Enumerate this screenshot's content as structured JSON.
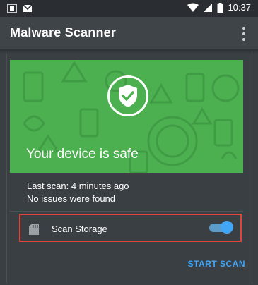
{
  "status_bar": {
    "time": "10:37",
    "icons": [
      "android-icon",
      "gmail-icon",
      "wifi-icon",
      "signal-icon",
      "battery-icon"
    ]
  },
  "app_bar": {
    "title": "Malware Scanner",
    "menu_icon": "overflow-menu-icon"
  },
  "hero": {
    "status_text": "Your device is safe",
    "background_color": "#4caf50",
    "icon": "shield-check-icon"
  },
  "scan_info": {
    "last_scan": "Last scan: 4 minutes ago",
    "issues": "No issues were found"
  },
  "storage_option": {
    "label": "Scan Storage",
    "icon": "sd-card-icon",
    "enabled": true
  },
  "actions": {
    "start_scan_label": "START SCAN",
    "accent_color": "#42a5f5"
  }
}
